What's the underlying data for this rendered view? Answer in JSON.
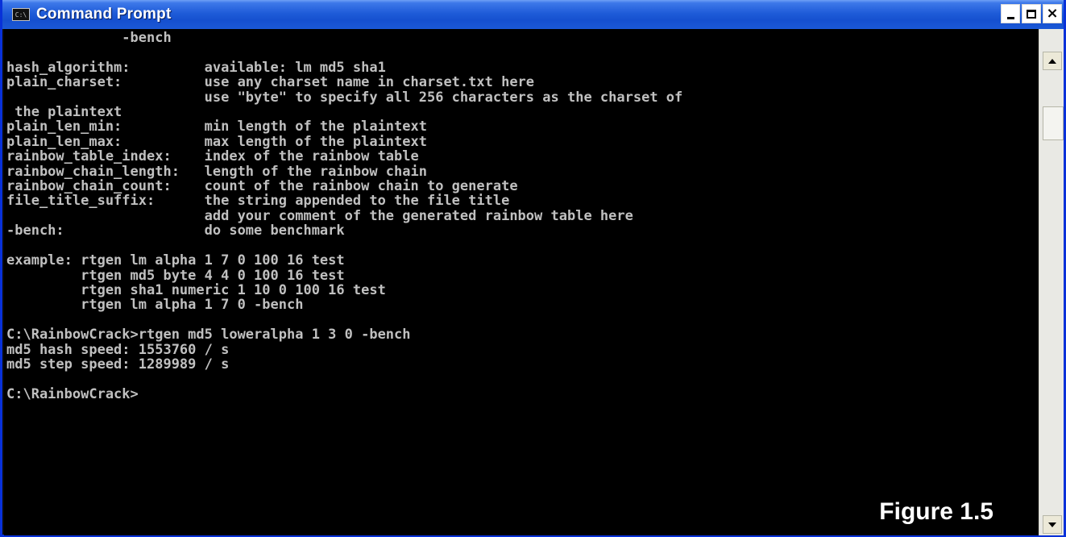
{
  "window": {
    "title": "Command Prompt",
    "icon_text": "C:\\",
    "controls": {
      "minimize": "minimize",
      "maximize": "maximize",
      "close": "×"
    }
  },
  "console": {
    "lines": [
      "              -bench",
      "",
      "hash_algorithm:         available: lm md5 sha1",
      "plain_charset:          use any charset name in charset.txt here",
      "                        use \"byte\" to specify all 256 characters as the charset of",
      " the plaintext",
      "plain_len_min:          min length of the plaintext",
      "plain_len_max:          max length of the plaintext",
      "rainbow_table_index:    index of the rainbow table",
      "rainbow_chain_length:   length of the rainbow chain",
      "rainbow_chain_count:    count of the rainbow chain to generate",
      "file_title_suffix:      the string appended to the file title",
      "                        add your comment of the generated rainbow table here",
      "-bench:                 do some benchmark",
      "",
      "example: rtgen lm alpha 1 7 0 100 16 test",
      "         rtgen md5 byte 4 4 0 100 16 test",
      "         rtgen sha1 numeric 1 10 0 100 16 test",
      "         rtgen lm alpha 1 7 0 -bench",
      "",
      "C:\\RainbowCrack>rtgen md5 loweralpha 1 3 0 -bench",
      "md5 hash speed: 1553760 / s",
      "md5 step speed: 1289989 / s",
      "",
      "C:\\RainbowCrack>"
    ]
  },
  "figure_label": "Figure 1.5",
  "colors": {
    "titlebar": "#1f5cd8",
    "console_bg": "#000000",
    "console_text": "#c0c0c0"
  }
}
